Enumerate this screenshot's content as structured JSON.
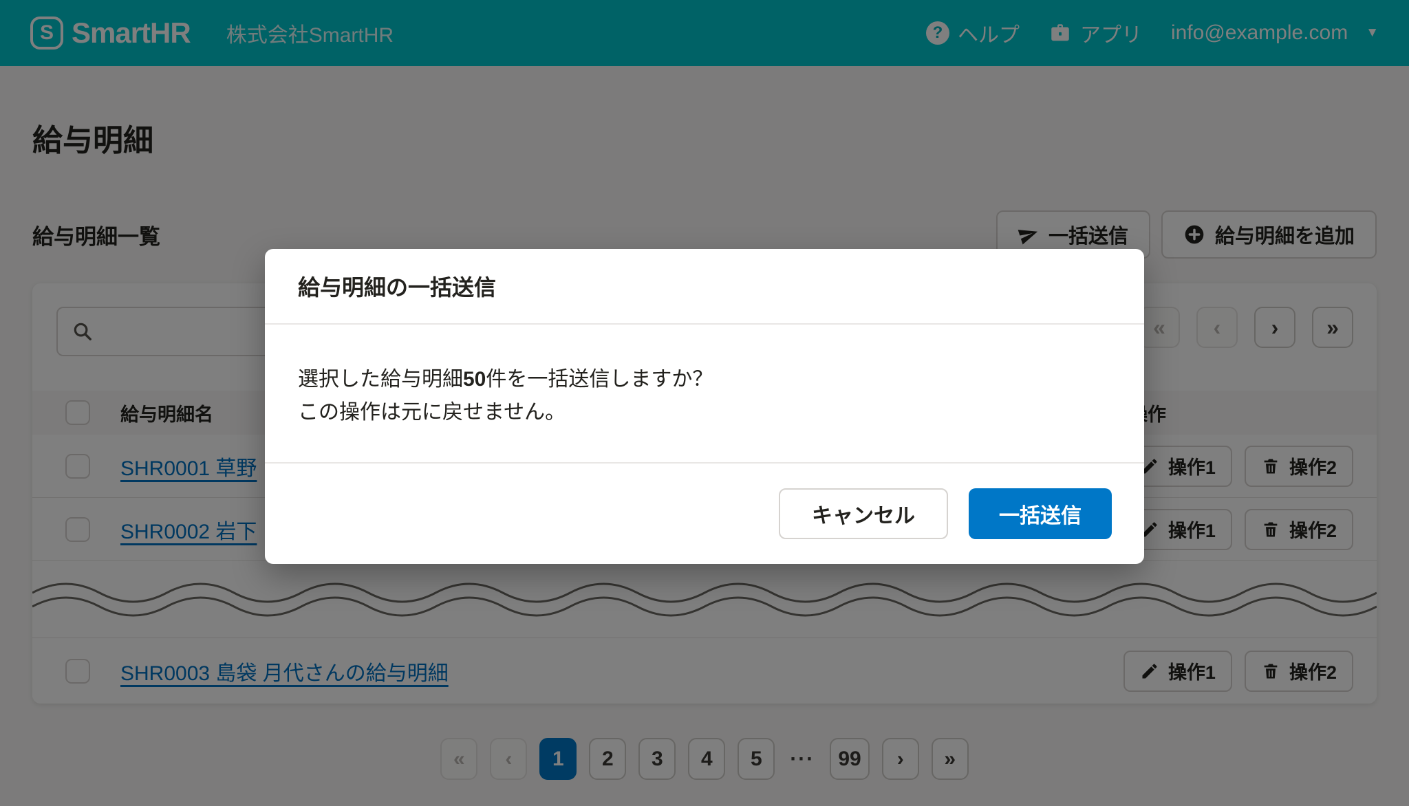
{
  "header": {
    "logo_letter": "S",
    "brand": "SmartHR",
    "company": "株式会社SmartHR",
    "help": "ヘルプ",
    "help_icon_glyph": "?",
    "apps": "アプリ",
    "account": "info@example.com"
  },
  "page": {
    "title": "給与明細",
    "list_title": "給与明細一覧",
    "bulk_send_button": "一括送信",
    "add_button": "給与明細を追加"
  },
  "table": {
    "columns": {
      "name": "給与明細名",
      "actions": "操作"
    },
    "rows": [
      {
        "name": "SHR0001 草野",
        "action1": "操作1",
        "action2": "操作2"
      },
      {
        "name": "SHR0002 岩下",
        "action1": "操作1",
        "action2": "操作2"
      },
      {
        "name": "SHR0003 島袋 月代さんの給与明細",
        "action1": "操作1",
        "action2": "操作2"
      }
    ]
  },
  "pagination": {
    "first": "«",
    "prev": "‹",
    "next": "›",
    "last": "»",
    "pages": [
      "1",
      "2",
      "3",
      "4",
      "5"
    ],
    "ellipsis": "···",
    "last_page": "99",
    "current_page": "1"
  },
  "modal": {
    "title": "給与明細の一括送信",
    "message_prefix": "選択した給与明細",
    "message_count": "50",
    "message_suffix": "件を一括送信しますか？",
    "message_line2": "この操作は元に戻せません。",
    "cancel_button": "キャンセル",
    "confirm_button": "一括送信"
  },
  "colors": {
    "header_teal": "#00c4cc",
    "primary_blue": "#0077c7",
    "link_blue": "#0071c1"
  }
}
